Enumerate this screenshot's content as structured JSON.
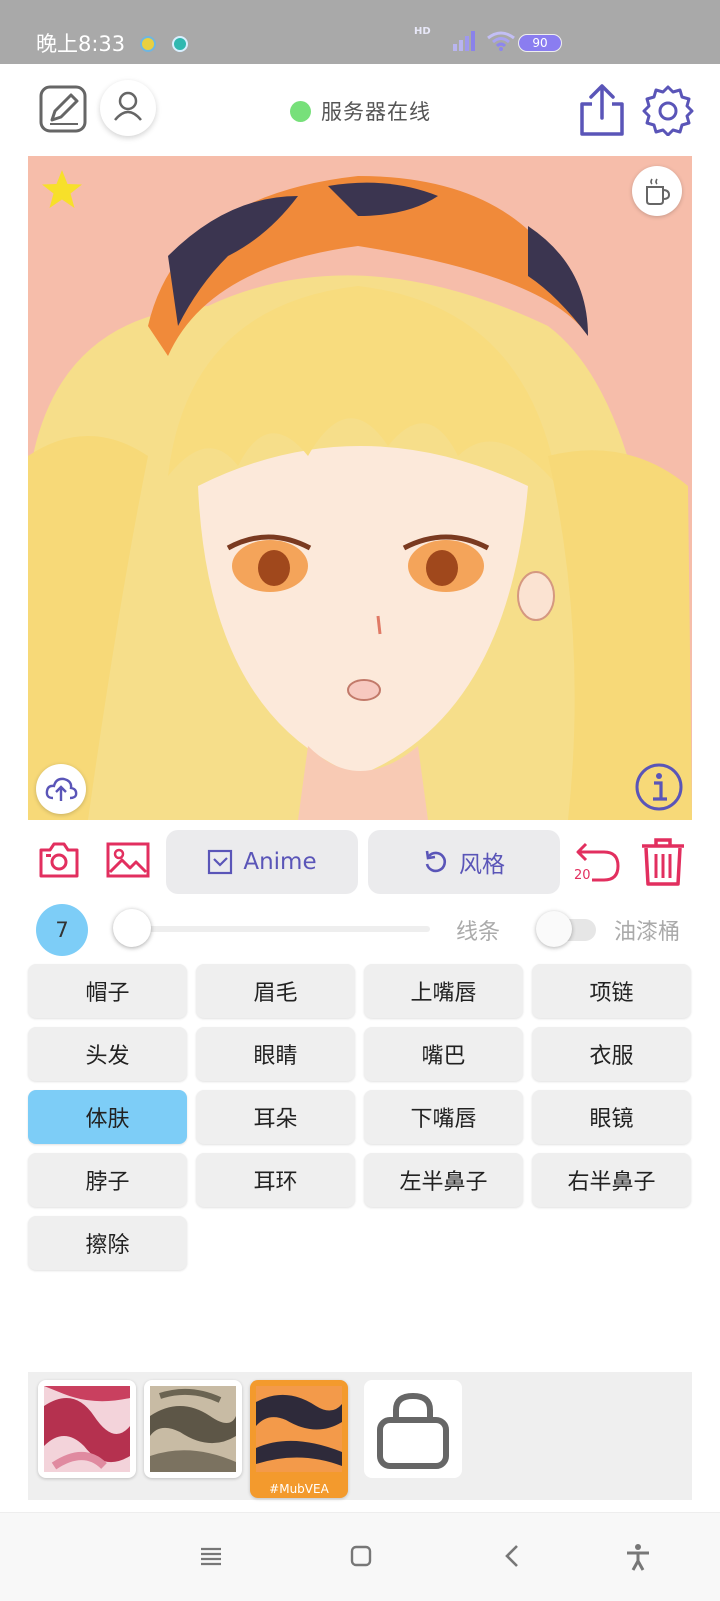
{
  "status_bar": {
    "time": "晚上8:33",
    "network_label": "HD",
    "battery": "90"
  },
  "header": {
    "server_status": "服务器在线",
    "icons": [
      "edit-icon",
      "user-icon",
      "share-icon",
      "gear-icon"
    ]
  },
  "canvas": {
    "icons": [
      "star-icon",
      "coffee-icon",
      "upload-cloud-icon",
      "info-icon"
    ]
  },
  "toolbar": {
    "anime_label": "Anime",
    "style_label": "风格",
    "undo_count": "20",
    "icons": [
      "camera-icon",
      "image-icon",
      "checkbox-icon",
      "refresh-icon",
      "undo-icon",
      "trash-icon"
    ]
  },
  "brush": {
    "size": "7",
    "slider_fraction": 0.05,
    "line_label": "线条",
    "bucket_label": "油漆桶",
    "bucket_enabled": false
  },
  "parts": [
    {
      "label": "帽子",
      "active": false
    },
    {
      "label": "眉毛",
      "active": false
    },
    {
      "label": "上嘴唇",
      "active": false
    },
    {
      "label": "项链",
      "active": false
    },
    {
      "label": "头发",
      "active": false
    },
    {
      "label": "眼睛",
      "active": false
    },
    {
      "label": "嘴巴",
      "active": false
    },
    {
      "label": "衣服",
      "active": false
    },
    {
      "label": "体肤",
      "active": true
    },
    {
      "label": "耳朵",
      "active": false
    },
    {
      "label": "下嘴唇",
      "active": false
    },
    {
      "label": "眼镜",
      "active": false
    },
    {
      "label": "脖子",
      "active": false
    },
    {
      "label": "耳环",
      "active": false
    },
    {
      "label": "左半鼻子",
      "active": false
    },
    {
      "label": "右半鼻子",
      "active": false
    },
    {
      "label": "擦除",
      "active": false
    }
  ],
  "palette": {
    "selected_tag": "#MubVEA",
    "icons": [
      "lock-icon"
    ]
  },
  "colors": {
    "accent_red": "#e22f5f",
    "accent_purple": "#5a55b8",
    "active_blue": "#7dcdf7",
    "online_green": "#77e07a"
  },
  "nav_bar": {
    "icons": [
      "menu-icon",
      "home-icon",
      "back-icon",
      "accessibility-icon"
    ]
  }
}
